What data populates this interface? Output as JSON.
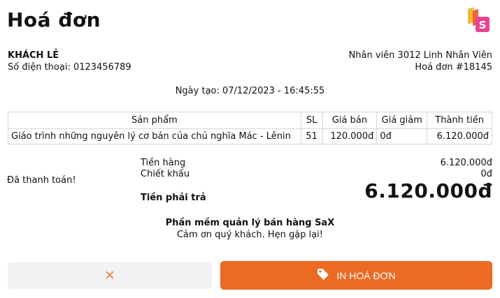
{
  "invoice": {
    "title": "Hoá đơn",
    "customer_name": "KHÁCH LẺ",
    "phone": "Số điện thoại: 0123456789",
    "staff": "Nhân viên 3012 Linh Nhân Viên",
    "invoice_no": "Hoá đơn #18145",
    "created": "Ngày tạo: 07/12/2023 - 16:45:55"
  },
  "table": {
    "headers": [
      "Sản phẩm",
      "SL",
      "Giá bán",
      "Giá giảm",
      "Thành tiền"
    ],
    "rows": [
      [
        "Giáo trình những nguyên lý cơ bản của chủ nghĩa Mác - Lênin",
        "51",
        "120.000đ",
        "0đ",
        "6.120.000đ"
      ]
    ]
  },
  "summary": {
    "paid_status": "Đã thanh toán!",
    "subtotal_label": "Tiền hàng",
    "subtotal_value": "6.120.000đ",
    "discount_label": "Chiết khấu",
    "discount_value": "0đ",
    "total_label": "Tiền phải trả",
    "total_value": "6.120.000đ"
  },
  "footer": {
    "software": "Phần mềm quản lý bán hàng SaX",
    "thanks": "Cảm ơn quý khách. Hẹn gặp lại!"
  },
  "logo": {
    "letter": "S",
    "colors": [
      "#f7b731",
      "#f0653c",
      "#e84393"
    ]
  },
  "buttons": {
    "cancel_icon": "close-icon",
    "print_icon": "tag-icon",
    "print_label": "IN HOÁ ĐƠN",
    "accent": "#eb6a24"
  }
}
